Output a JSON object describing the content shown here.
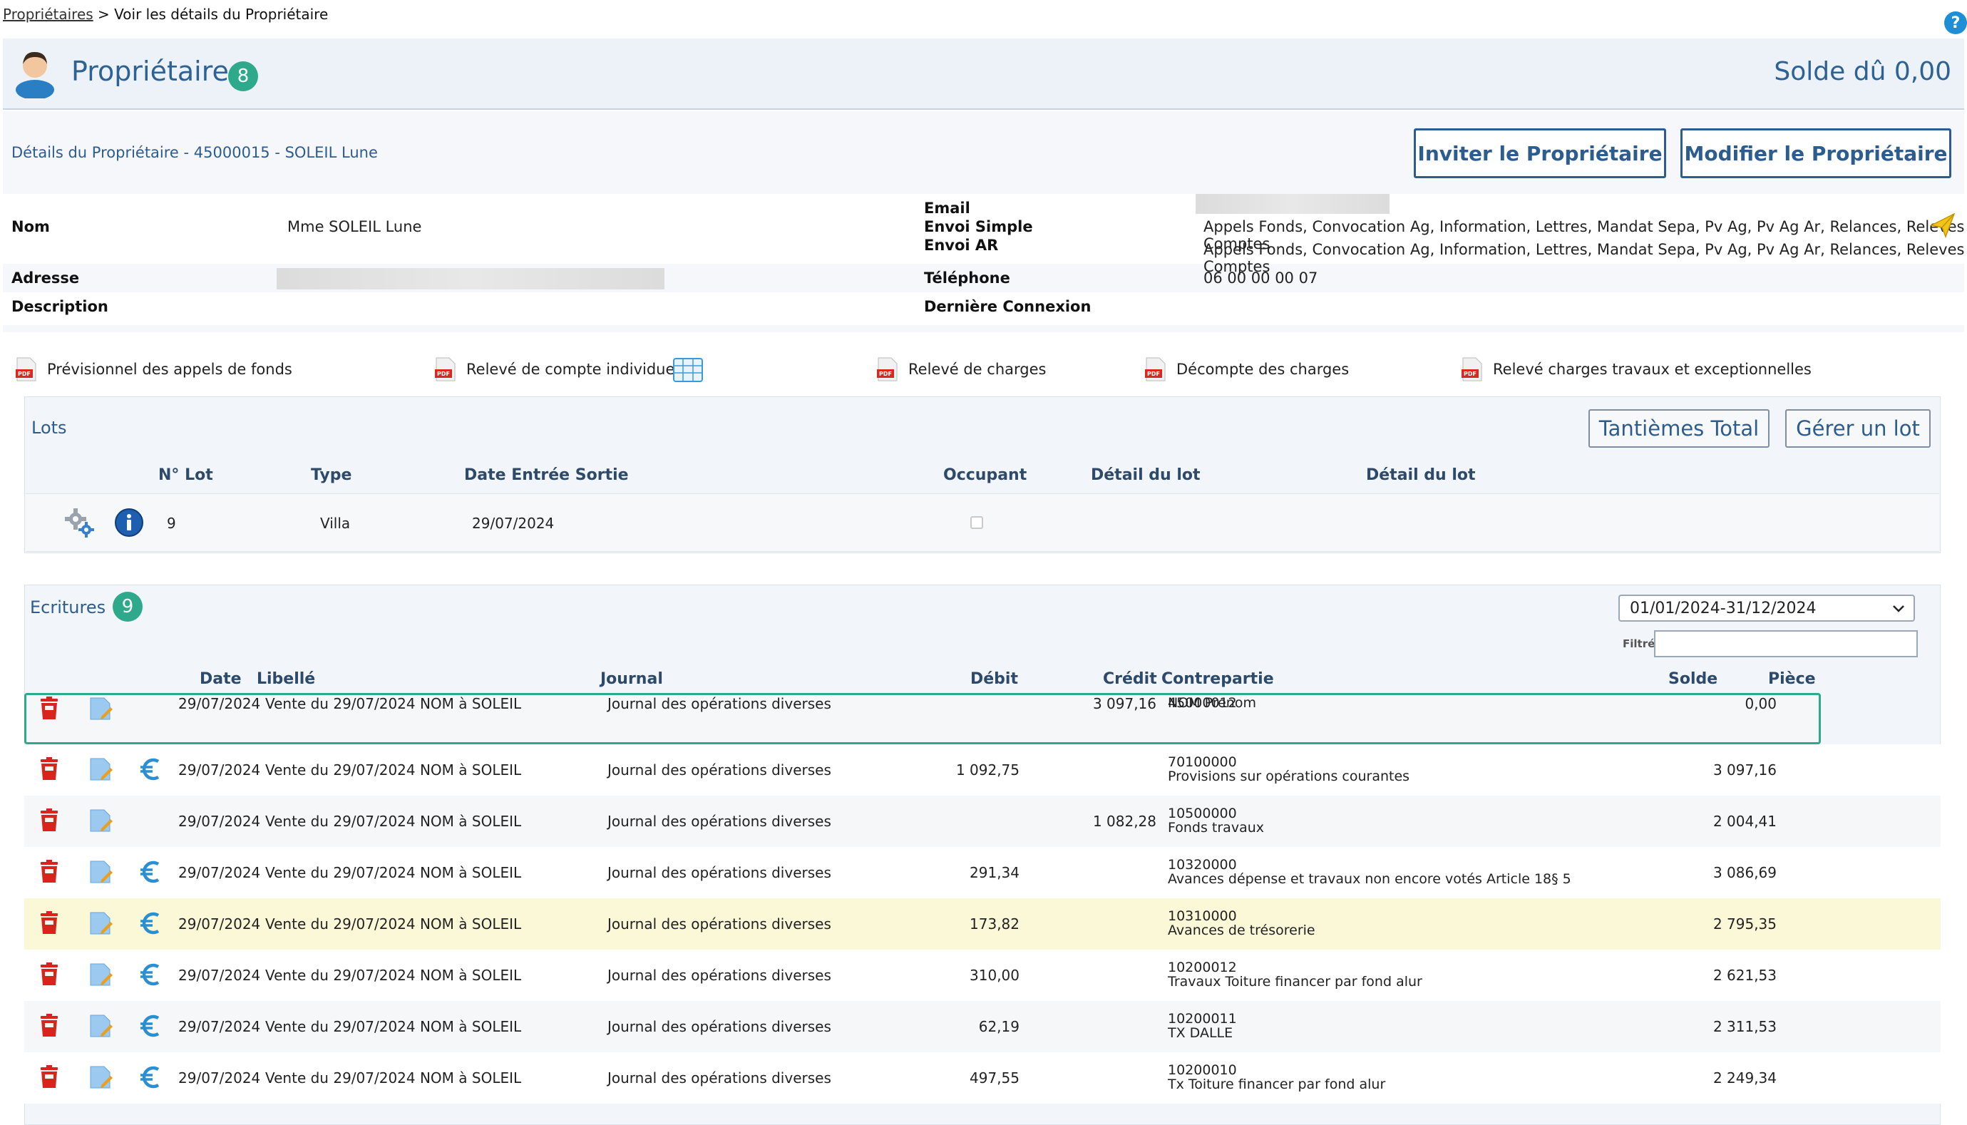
{
  "breadcrumb": {
    "parent": "Propriétaires",
    "separator": ">",
    "current": "Voir les détails du Propriétaire"
  },
  "header": {
    "title": "Propriétaire",
    "badge": "8",
    "solde": "Solde dû 0,00"
  },
  "details": {
    "title": "Détails du Propriétaire - 45000015 - SOLEIL Lune",
    "invite_button": "Inviter le Propriétaire",
    "edit_button": "Modifier le Propriétaire",
    "nom_label": "Nom",
    "nom_value": "Mme SOLEIL Lune",
    "email_label": "Email",
    "envoi_simple_label": "Envoi Simple",
    "envoi_simple_value": "Appels Fonds, Convocation Ag, Information, Lettres, Mandat Sepa, Pv Ag, Pv Ag Ar, Relances, Releves Comptes",
    "envoi_ar_label": "Envoi AR",
    "envoi_ar_value": "Appels Fonds, Convocation Ag, Information, Lettres, Mandat Sepa, Pv Ag, Pv Ag Ar, Relances, Releves Comptes",
    "adresse_label": "Adresse",
    "telephone_label": "Téléphone",
    "telephone_value": "06 00 00 00 07",
    "description_label": "Description",
    "derniere_connexion_label": "Dernière Connexion"
  },
  "documents": [
    "Prévisionnel des appels de fonds",
    "Relevé de compte individuel",
    "Relevé de charges",
    "Décompte des charges",
    "Relevé charges travaux et exceptionnelles"
  ],
  "lots": {
    "title": "Lots",
    "tantiemes_button": "Tantièmes Total",
    "gerer_button": "Gérer un lot",
    "columns": [
      "N° Lot",
      "Type",
      "Date Entrée Sortie",
      "Occupant",
      "Détail du lot",
      "Détail du lot"
    ],
    "rows": [
      {
        "lot": "9",
        "type": "Villa",
        "date": "29/07/2024"
      }
    ]
  },
  "ecritures": {
    "title": "Ecritures",
    "badge": "9",
    "period": "01/01/2024-31/12/2024",
    "filter_label": "Filtré",
    "columns": [
      "Date",
      "Libellé",
      "Journal",
      "Débit",
      "Crédit",
      "Contrepartie",
      "Solde",
      "Pièce"
    ],
    "rows": [
      {
        "date": "29/07/2024",
        "libelle": "Vente du 29/07/2024 NOM à SOLEIL",
        "journal": "Journal des opérations diverses",
        "debit": "",
        "credit": "3 097,16",
        "cp_code": "45000012",
        "cp_label": "NOM Prenom",
        "solde": "0,00"
      },
      {
        "date": "29/07/2024",
        "libelle": "Vente du 29/07/2024 NOM à SOLEIL",
        "journal": "Journal des opérations diverses",
        "debit": "1 092,75",
        "credit": "",
        "cp_code": "70100000",
        "cp_label": "Provisions sur opérations courantes",
        "solde": "3 097,16"
      },
      {
        "date": "29/07/2024",
        "libelle": "Vente du 29/07/2024 NOM à SOLEIL",
        "journal": "Journal des opérations diverses",
        "debit": "",
        "credit": "1 082,28",
        "cp_code": "10500000",
        "cp_label": "Fonds travaux",
        "solde": "2 004,41"
      },
      {
        "date": "29/07/2024",
        "libelle": "Vente du 29/07/2024 NOM à SOLEIL",
        "journal": "Journal des opérations diverses",
        "debit": "291,34",
        "credit": "",
        "cp_code": "10320000",
        "cp_label": "Avances dépense et travaux non encore votés Article 18§ 5",
        "solde": "3 086,69"
      },
      {
        "date": "29/07/2024",
        "libelle": "Vente du 29/07/2024 NOM à SOLEIL",
        "journal": "Journal des opérations diverses",
        "debit": "173,82",
        "credit": "",
        "cp_code": "10310000",
        "cp_label": "Avances de trésorerie",
        "solde": "2 795,35"
      },
      {
        "date": "29/07/2024",
        "libelle": "Vente du 29/07/2024 NOM à SOLEIL",
        "journal": "Journal des opérations diverses",
        "debit": "310,00",
        "credit": "",
        "cp_code": "10200012",
        "cp_label": "Travaux Toiture financer par fond alur",
        "solde": "2 621,53"
      },
      {
        "date": "29/07/2024",
        "libelle": "Vente du 29/07/2024 NOM à SOLEIL",
        "journal": "Journal des opérations diverses",
        "debit": "62,19",
        "credit": "",
        "cp_code": "10200011",
        "cp_label": "TX DALLE",
        "solde": "2 311,53"
      },
      {
        "date": "29/07/2024",
        "libelle": "Vente du 29/07/2024 NOM à SOLEIL",
        "journal": "Journal des opérations diverses",
        "debit": "497,55",
        "credit": "",
        "cp_code": "10200010",
        "cp_label": "Tx Toiture financer par fond alur",
        "solde": "2 249,34"
      }
    ]
  },
  "colors": {
    "accent": "#2d5c8f",
    "badge": "#2ea98c",
    "highlight_row": "#fbf8d8",
    "selected_border": "#2ea98c",
    "delete": "#d9241c",
    "euro": "#2a8fd0"
  }
}
